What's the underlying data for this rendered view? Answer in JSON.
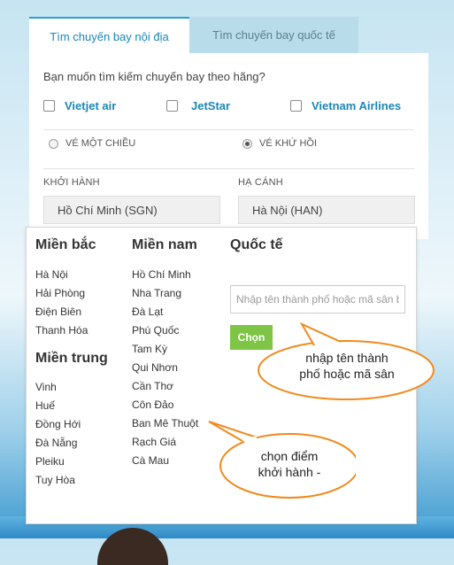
{
  "tabs": {
    "domestic": "Tìm chuyến bay nội địa",
    "international": "Tìm chuyến bay quốc tế"
  },
  "search_form": {
    "airline_question": "Bạn muốn tìm kiếm chuyến bay theo hãng?",
    "airlines": [
      "Vietjet air",
      "JetStar",
      "Vietnam Airlines"
    ],
    "trip_types": [
      "VÉ MỘT CHIỀU",
      "VÉ KHỨ HỒI"
    ],
    "selected_trip_type": "VÉ KHỨ HỒI",
    "departure_label": "KHỞI HÀNH",
    "departure_value": "Hồ Chí Minh (SGN)",
    "arrival_label": "HẠ CÁNH",
    "arrival_value": "Hà Nội (HAN)"
  },
  "city_dropdown": {
    "north": {
      "title": "Miền bắc",
      "cities": [
        "Hà Nội",
        "Hải Phòng",
        "Điện Biên",
        "Thanh Hóa"
      ]
    },
    "central": {
      "title": "Miền trung",
      "cities": [
        "Vinh",
        "Huế",
        "Đồng Hới",
        "Đà Nẵng",
        "Pleiku",
        "Tuy Hòa"
      ]
    },
    "south": {
      "title": "Miền nam",
      "cities": [
        "Hồ Chí Minh",
        "Nha Trang",
        "Đà Lạt",
        "Phú Quốc",
        "Tam Kỳ",
        "Qui Nhơn",
        "Cần Thơ",
        "Côn Đảo",
        "Ban Mê Thuột",
        "Rạch Giá",
        "Cà Mau"
      ]
    },
    "international": {
      "title": "Quốc tế",
      "input_placeholder": "Nhập tên thành phố hoặc mã sân bay",
      "button_label": "Chọn"
    }
  },
  "annotations": {
    "input_hint": [
      "nhập tên thành",
      "phố hoặc mã sân"
    ],
    "departure_hint": [
      "chọn điểm",
      "khởi hành -"
    ]
  },
  "colors": {
    "accent": "#1a87b7",
    "button": "#7ec545",
    "callout_border": "#f08a1c"
  }
}
